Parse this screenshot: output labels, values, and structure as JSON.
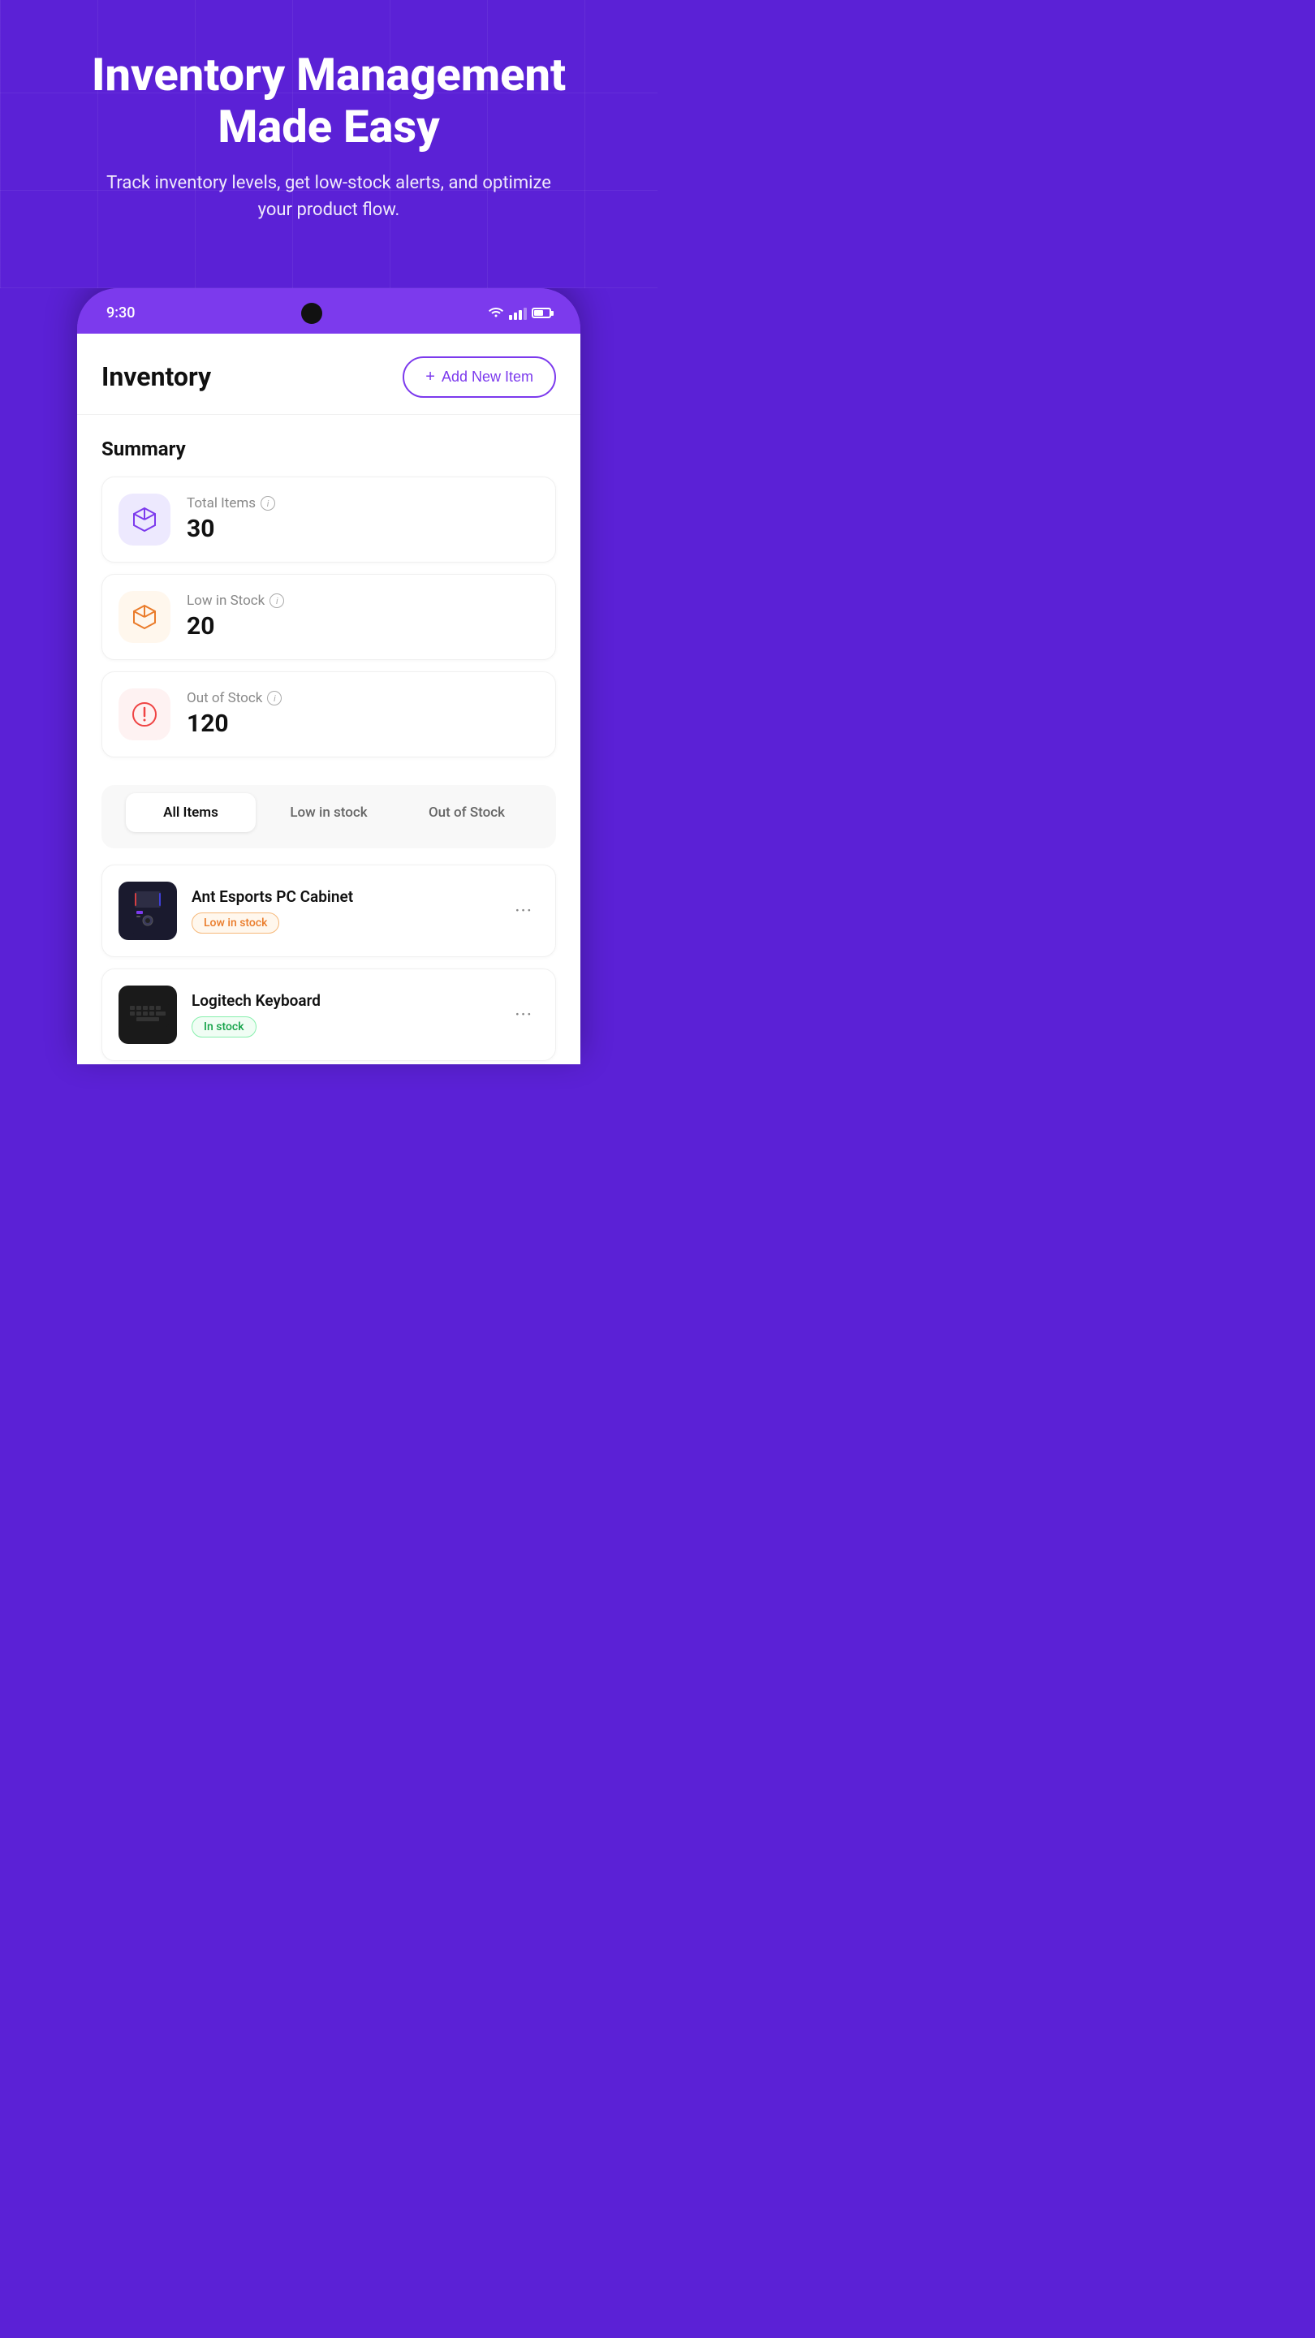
{
  "hero": {
    "title": "Inventory Management Made Easy",
    "subtitle": "Track inventory levels, get low-stock alerts, and optimize your product flow."
  },
  "statusBar": {
    "time": "9:30",
    "wifiIcon": "wifi",
    "signalIcon": "signal",
    "batteryIcon": "battery"
  },
  "header": {
    "title": "Inventory",
    "addButton": "Add New Item"
  },
  "summary": {
    "sectionTitle": "Summary",
    "cards": [
      {
        "label": "Total Items",
        "value": "30",
        "iconType": "purple",
        "iconName": "box-icon"
      },
      {
        "label": "Low in Stock",
        "value": "20",
        "iconType": "orange",
        "iconName": "box-warning-icon"
      },
      {
        "label": "Out of Stock",
        "value": "120",
        "iconType": "red",
        "iconName": "alert-icon"
      }
    ]
  },
  "filterTabs": {
    "tabs": [
      {
        "label": "All Items",
        "active": true
      },
      {
        "label": "Low in stock",
        "active": false
      },
      {
        "label": "Out of Stock",
        "active": false
      }
    ]
  },
  "items": [
    {
      "name": "Ant Esports PC Cabinet",
      "badge": "Low in stock",
      "badgeType": "low",
      "imageType": "pc-cabinet"
    },
    {
      "name": "Logitech Keyboard",
      "badge": "In stock",
      "badgeType": "instock",
      "imageType": "keyboard"
    }
  ]
}
